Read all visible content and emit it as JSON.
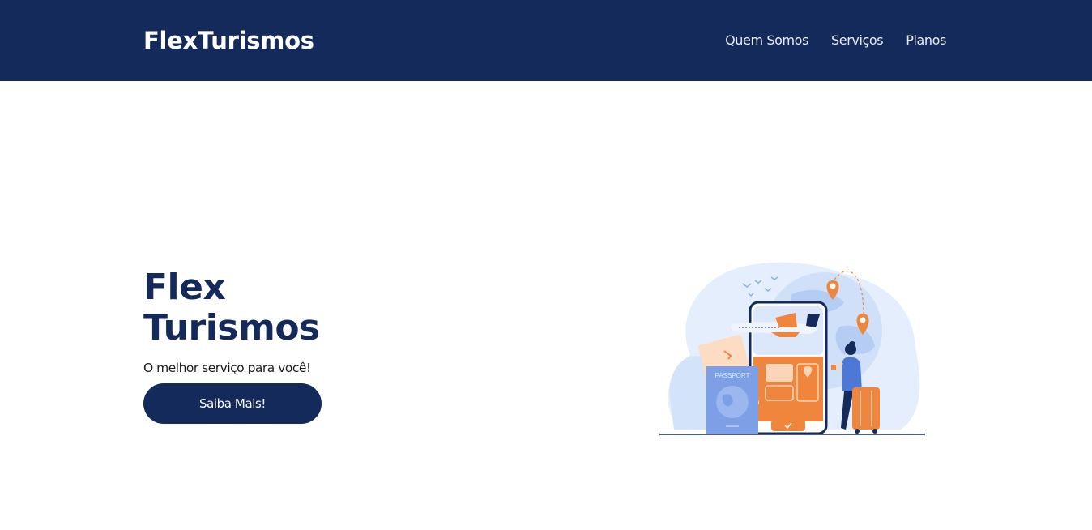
{
  "header": {
    "brand": "FlexTurismos",
    "nav": [
      {
        "label": "Quem Somos"
      },
      {
        "label": "Serviços"
      },
      {
        "label": "Planos"
      }
    ]
  },
  "hero": {
    "title_line1": "Flex",
    "title_line2": "Turismos",
    "subtitle": "O melhor serviço para você!",
    "cta_label": "Saiba Mais!",
    "illustration": {
      "passport_label": "PASSPORT",
      "icons": [
        "airplane-icon",
        "location-pin-icon",
        "globe-icon",
        "passport-icon",
        "suitcase-icon",
        "traveler-figure"
      ]
    }
  },
  "colors": {
    "primary": "#132a5a",
    "accent": "#f0853e",
    "light_blue": "#dbe8fb",
    "passport_blue": "#7c9fe6",
    "background": "#ffffff"
  }
}
